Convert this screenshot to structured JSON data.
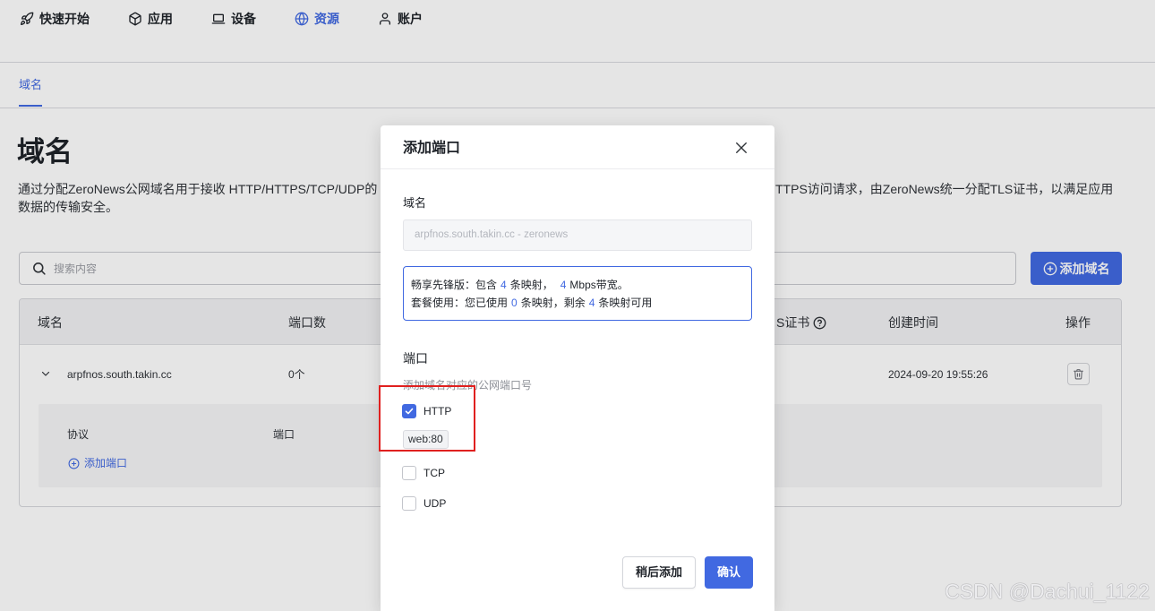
{
  "colors": {
    "accent": "#4169e1",
    "annotation": "#e0201f"
  },
  "nav": {
    "items": [
      {
        "label": "快速开始",
        "icon": "rocket-icon",
        "active": false
      },
      {
        "label": "应用",
        "icon": "cube-icon",
        "active": false
      },
      {
        "label": "设备",
        "icon": "laptop-icon",
        "active": false
      },
      {
        "label": "资源",
        "icon": "globe-icon",
        "active": true
      },
      {
        "label": "账户",
        "icon": "user-icon",
        "active": false
      }
    ]
  },
  "subtabs": [
    {
      "label": "域名",
      "active": true
    }
  ],
  "page": {
    "title": "域名",
    "description": {
      "line1_left": "通过分配ZeroNews公网域名用于接收 HTTP/HTTPS/TCP/UDP的",
      "line1_right": "TTPS访问请求，由ZeroNews统一分配TLS证书，以满足应用",
      "line2": "数据的传输安全。"
    }
  },
  "search": {
    "placeholder": "搜索内容",
    "icon": "search-icon"
  },
  "toolbar": {
    "add_domain_label": "添加域名",
    "add_domain_icon": "plus-circle-icon"
  },
  "table": {
    "columns": [
      "域名",
      "端口数",
      "S证书",
      "创建时间",
      "操作"
    ],
    "rows": [
      {
        "domain": "arpfnos.south.takin.cc",
        "port_count": "0个",
        "created_at": "2024-09-20 19:55:26",
        "expanded": true,
        "detail": {
          "protocol_header": "协议",
          "port_header": "端口",
          "add_port_label": "添加端口"
        }
      }
    ]
  },
  "modal": {
    "title": "添加端口",
    "domain_label": "域名",
    "domain_value": "arpfnos.south.takin.cc - zeronews",
    "plan": {
      "line1": {
        "prefix": "畅享先锋版：包含",
        "mappings": "4",
        "mappings_unit": "条映射，",
        "bandwidth": "4",
        "bandwidth_unit": "Mbps带宽。"
      },
      "line2": {
        "prefix": "套餐使用：您已使用",
        "used": "0",
        "used_unit": "条映射，剩余",
        "remaining": "4",
        "remaining_unit": "条映射可用"
      }
    },
    "port_label": "端口",
    "port_hint": "添加域名对应的公网端口号",
    "protocols": [
      {
        "label": "HTTP",
        "checked": true,
        "tags": [
          "web:80"
        ]
      },
      {
        "label": "TCP",
        "checked": false
      },
      {
        "label": "UDP",
        "checked": false
      }
    ],
    "cancel_label": "稍后添加",
    "confirm_label": "确认"
  },
  "watermark": "CSDN @Dachui_1122"
}
